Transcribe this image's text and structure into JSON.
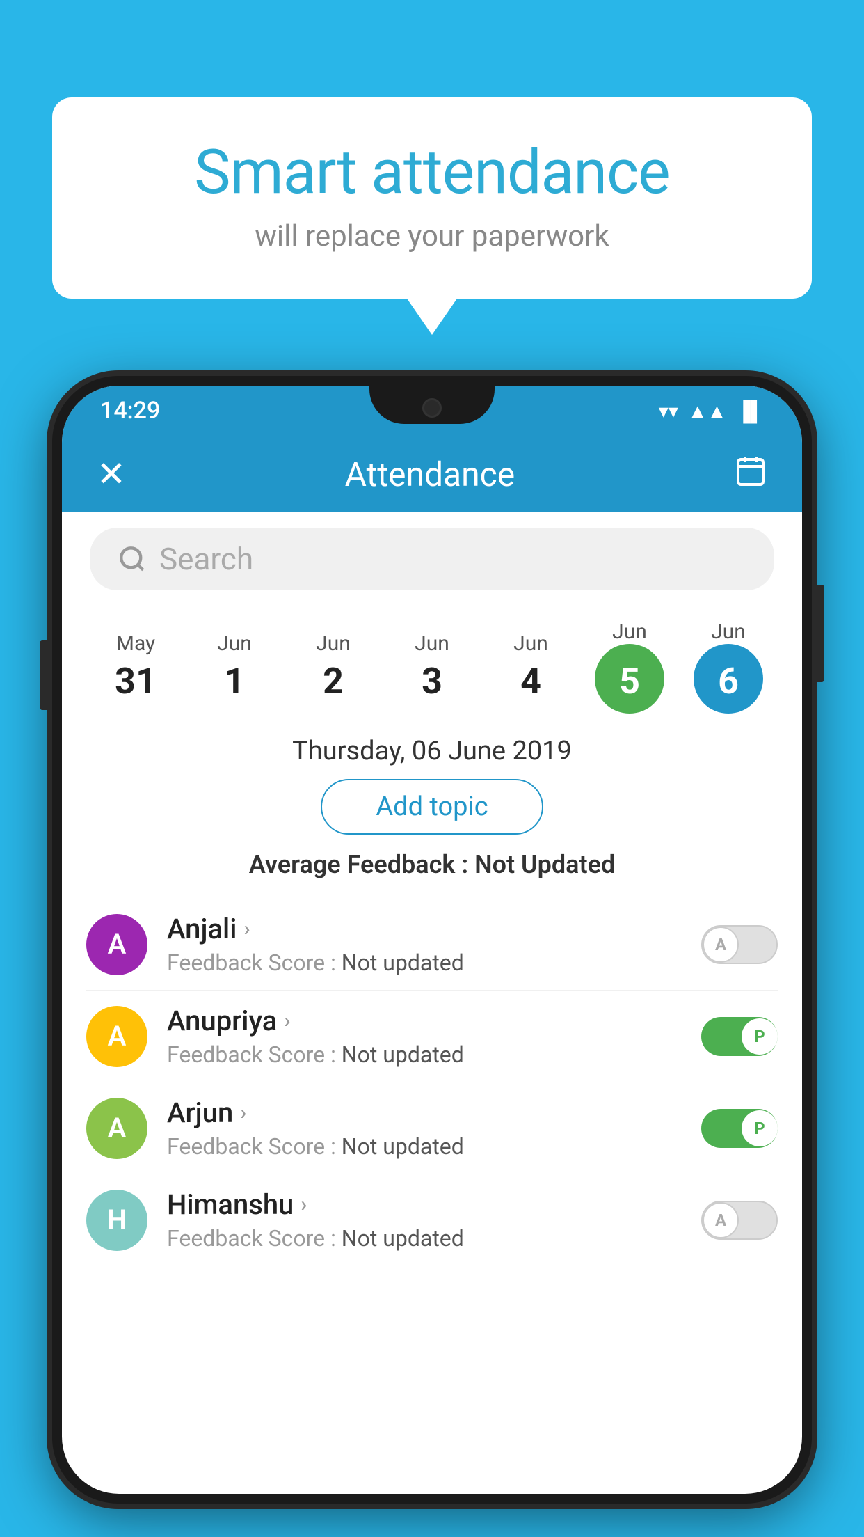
{
  "background_color": "#29b6e8",
  "bubble": {
    "title": "Smart attendance",
    "subtitle": "will replace your paperwork"
  },
  "status_bar": {
    "time": "14:29",
    "wifi_icon": "▼",
    "signal_icon": "▲",
    "battery_icon": "▌"
  },
  "header": {
    "close_icon": "✕",
    "title": "Attendance",
    "calendar_icon": "📅"
  },
  "search": {
    "placeholder": "Search"
  },
  "calendar": {
    "days": [
      {
        "month": "May",
        "date": "31",
        "active": false
      },
      {
        "month": "Jun",
        "date": "1",
        "active": false
      },
      {
        "month": "Jun",
        "date": "2",
        "active": false
      },
      {
        "month": "Jun",
        "date": "3",
        "active": false
      },
      {
        "month": "Jun",
        "date": "4",
        "active": false
      },
      {
        "month": "Jun",
        "date": "5",
        "active": true,
        "color": "green"
      },
      {
        "month": "Jun",
        "date": "6",
        "active": true,
        "color": "blue"
      }
    ]
  },
  "selected_date": "Thursday, 06 June 2019",
  "add_topic_label": "Add topic",
  "average_feedback_label": "Average Feedback : ",
  "average_feedback_value": "Not Updated",
  "students": [
    {
      "name": "Anjali",
      "initial": "A",
      "avatar_color": "avatar-purple",
      "feedback_label": "Feedback Score : ",
      "feedback_value": "Not updated",
      "toggle": "off",
      "toggle_label": "A"
    },
    {
      "name": "Anupriya",
      "initial": "A",
      "avatar_color": "avatar-yellow",
      "feedback_label": "Feedback Score : ",
      "feedback_value": "Not updated",
      "toggle": "on",
      "toggle_label": "P"
    },
    {
      "name": "Arjun",
      "initial": "A",
      "avatar_color": "avatar-green",
      "feedback_label": "Feedback Score : ",
      "feedback_value": "Not updated",
      "toggle": "on",
      "toggle_label": "P"
    },
    {
      "name": "Himanshu",
      "initial": "H",
      "avatar_color": "avatar-teal",
      "feedback_label": "Feedback Score : ",
      "feedback_value": "Not updated",
      "toggle": "off",
      "toggle_label": "A"
    }
  ]
}
